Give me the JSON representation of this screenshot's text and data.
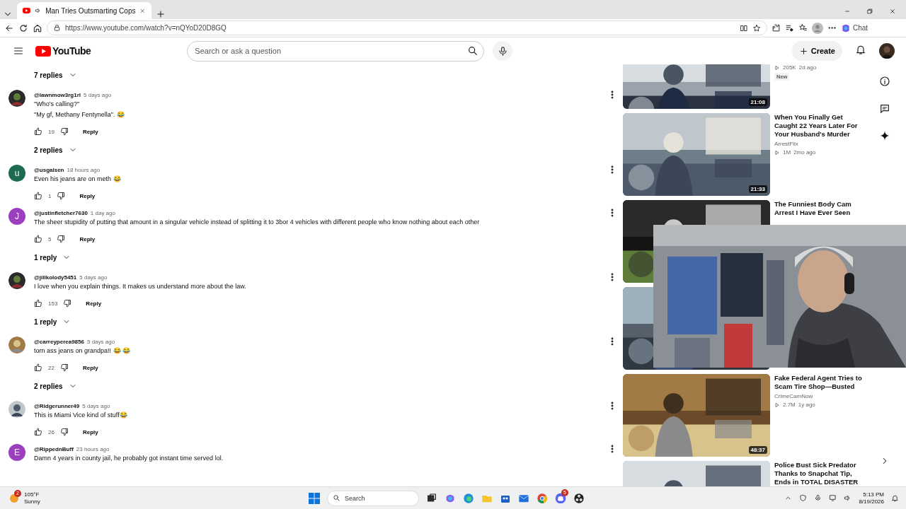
{
  "browser": {
    "tab": {
      "title": "Man Tries Outsmarting Cops"
    },
    "url": "https://www.youtube.com/watch?v=nQYoD20D8GQ",
    "chat_button": "Chat"
  },
  "header": {
    "logo": "YouTube",
    "search": {
      "placeholder": "Search or ask a question"
    },
    "create_button": "Create"
  },
  "comments": [
    {
      "kind": "replies",
      "label": "7 replies"
    },
    {
      "kind": "comment",
      "user": "@lawnmow3rg1rl",
      "age": "5 days ago",
      "lines": [
        "\"Who's calling?\"",
        "\"My gf, Methany Fentynella\". 😂"
      ],
      "likes": "19",
      "reply_label": "Reply",
      "avatar": {
        "kind": "picture"
      }
    },
    {
      "kind": "replies",
      "label": "2 replies"
    },
    {
      "kind": "comment",
      "user": "@usgalsen",
      "age": "18 hours ago",
      "lines": [
        "Even his jeans are on meth 😂"
      ],
      "likes": "1",
      "reply_label": "Reply",
      "avatar": {
        "kind": "letter",
        "letter": "u",
        "color": "#1e6b4f"
      }
    },
    {
      "kind": "comment",
      "user": "@justinfletcher7630",
      "age": "1 day ago",
      "lines": [
        "The sheer stupidity of putting that amount in a singular vehicle instead of splitting it to 3bor 4 vehicles with different people who know nothing about each other"
      ],
      "likes": "5",
      "reply_label": "Reply",
      "avatar": {
        "kind": "letter",
        "letter": "J",
        "color": "#9c3fbf"
      }
    },
    {
      "kind": "replies",
      "label": "1 reply"
    },
    {
      "kind": "comment",
      "user": "@jillkolody5451",
      "age": "5 days ago",
      "lines": [
        "I love when you explain things. It makes us understand more about the law."
      ],
      "likes": "153",
      "reply_label": "Reply",
      "avatar": {
        "kind": "picture"
      }
    },
    {
      "kind": "replies",
      "label": "1 reply"
    },
    {
      "kind": "comment",
      "user": "@carreyperea9856",
      "age": "5 days ago",
      "lines": [
        "torn ass jeans on grandpa!! 😂 😂"
      ],
      "likes": "22",
      "reply_label": "Reply",
      "avatar": {
        "kind": "picture"
      }
    },
    {
      "kind": "replies",
      "label": "2 replies"
    },
    {
      "kind": "comment",
      "user": "@Ridgerunner49",
      "age": "5 days ago",
      "lines": [
        "This is Miami Vice kind of stuff😂"
      ],
      "likes": "26",
      "reply_label": "Reply",
      "avatar": {
        "kind": "picture"
      }
    },
    {
      "kind": "comment",
      "user": "@RippednBuff",
      "age": "23 hours ago",
      "lines": [
        "Damn 4 years in county jail, he probably got instant time served lol."
      ],
      "avatar": {
        "kind": "letter",
        "letter": "E",
        "color": "#9c3fbf"
      }
    }
  ],
  "videos": [
    {
      "kind": "video",
      "partial": true,
      "duration": "21:08",
      "views": "205K",
      "age": "2d ago",
      "badge": "New"
    },
    {
      "kind": "video",
      "title": "When You Finally Get Caught 22 Years Later For Your Husband's Murder",
      "channel": "ArrestFlix",
      "views": "1M",
      "age": "2mo ago",
      "duration": "21:33"
    },
    {
      "kind": "video",
      "title": "The Funniest Body Cam Arrest I Have Ever Seen"
    },
    {
      "kind": "video"
    },
    {
      "kind": "video",
      "title": "Fake Federal Agent Tries to Scam Tire Shop—Busted",
      "channel": "CrimeCamNow",
      "views": "2.7M",
      "age": "1y ago",
      "duration": "48:37"
    },
    {
      "kind": "video",
      "title": "Police Bust Sick Predator Thanks to Snapchat Tip, Ends in TOTAL DISASTER"
    }
  ],
  "taskbar": {
    "weather": {
      "badge": "2",
      "temperature": "105°F",
      "condition": "Sunny"
    },
    "search": {
      "placeholder": "Search"
    },
    "discord_badge": "5",
    "time": "5:13 PM",
    "date": "8/19/2026"
  }
}
